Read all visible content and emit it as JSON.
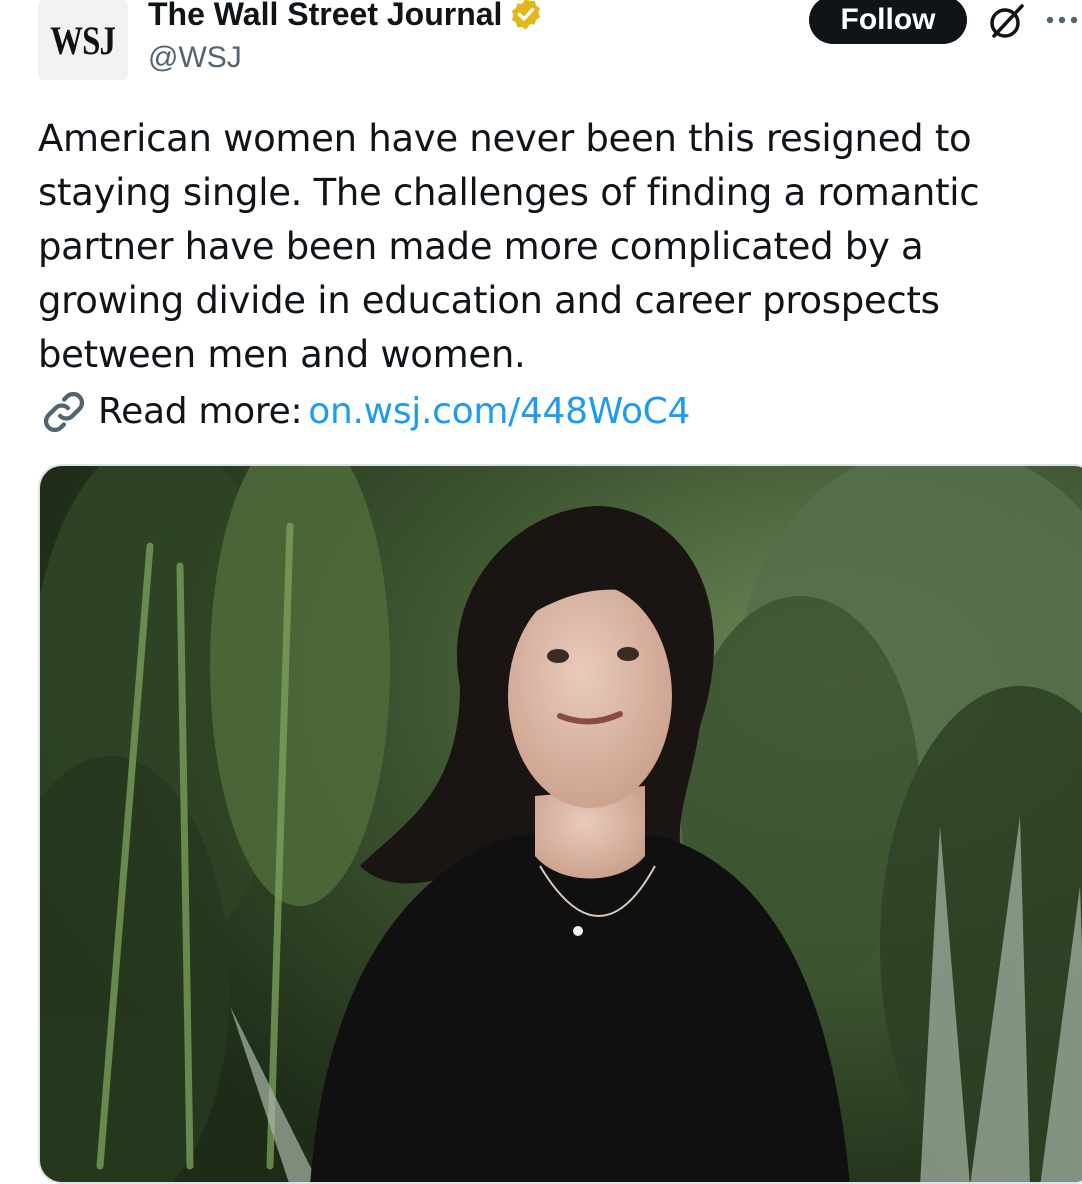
{
  "account": {
    "avatar_text": "WSJ",
    "display_name": "The Wall Street Journal",
    "handle": "@WSJ",
    "verified_badge_icon": "verified-badge-icon"
  },
  "actions": {
    "follow_label": "Follow",
    "grok_icon": "grok-icon",
    "more_icon": "more-options-icon"
  },
  "tweet": {
    "text": "American women have never been this resigned to staying single. The challenges of finding a romantic partner have been made more complicated by a growing divide in education and career prospects between men and women.",
    "read_more_label": "Read more:",
    "link_text": "on.wsj.com/448WoC4",
    "link_icon": "link-icon"
  },
  "media": {
    "type": "photo"
  },
  "colors": {
    "accent_link": "#1d9bf0",
    "follow_bg": "#0f1419",
    "verified_gold": "#e2b719"
  }
}
